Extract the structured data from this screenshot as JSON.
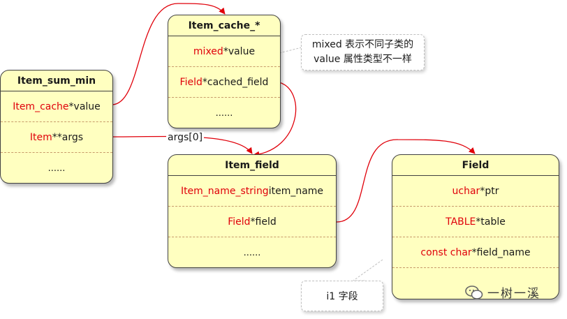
{
  "boxes": {
    "item_sum_min": {
      "title": "Item_sum_min",
      "rows": [
        {
          "type": "Item_cache",
          "rest": " *value"
        },
        {
          "type": "Item",
          "rest": " **args"
        },
        {
          "type": "",
          "rest": "......"
        }
      ]
    },
    "item_cache": {
      "title": "Item_cache_*",
      "rows": [
        {
          "type": "mixed",
          "rest": " *value"
        },
        {
          "type": "Field",
          "rest": " *cached_field"
        },
        {
          "type": "",
          "rest": "......"
        }
      ]
    },
    "item_field": {
      "title": "Item_field",
      "rows": [
        {
          "type": "Item_name_string",
          "rest": " item_name"
        },
        {
          "type": "Field",
          "rest": " *field"
        },
        {
          "type": "",
          "rest": "......"
        }
      ]
    },
    "field": {
      "title": "Field",
      "rows": [
        {
          "type": "uchar",
          "rest": " *ptr"
        },
        {
          "type": "TABLE",
          "rest": " *table"
        },
        {
          "type": "const char",
          "rest": " *field_name"
        }
      ]
    }
  },
  "notes": {
    "mixed_line1": "mixed 表示不同子类的",
    "mixed_line2": "value 属性类型不一样",
    "i1": "i1 字段"
  },
  "arrow_labels": {
    "args": "args[0]"
  },
  "watermark": "一树一溪",
  "colors": {
    "box_fill": "#ffffc0",
    "type_text": "#e0000a",
    "connector": "#e0000a"
  }
}
